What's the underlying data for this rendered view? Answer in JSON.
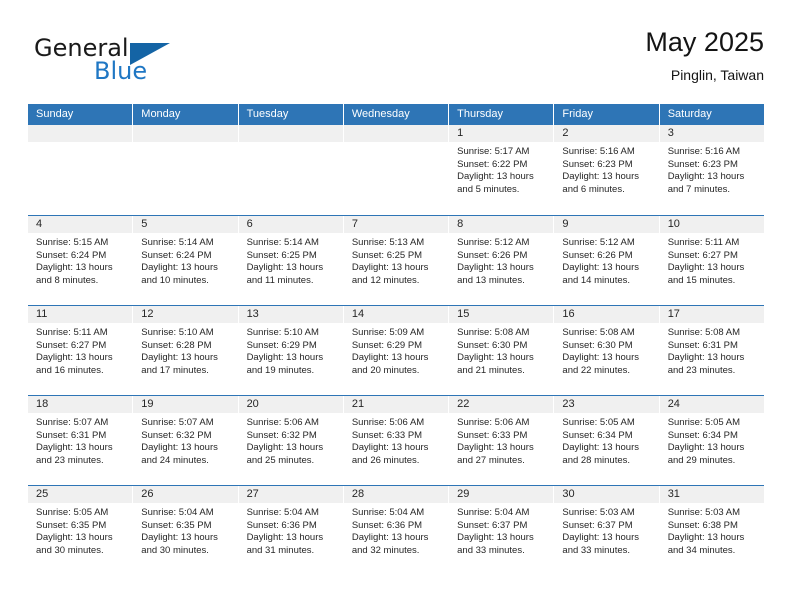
{
  "brand": {
    "name_primary": "General",
    "name_secondary": "Blue",
    "flag_icon": "triangle-flag-icon",
    "accent_color": "#1464a5"
  },
  "header": {
    "title": "May 2025",
    "subtitle": "Pinglin, Taiwan"
  },
  "theme": {
    "header_row_bg": "#2e75b6",
    "row_separator": "#2e75b6",
    "date_band_bg": "#f0f0f0",
    "text_color": "#262626"
  },
  "weekdays": [
    "Sunday",
    "Monday",
    "Tuesday",
    "Wednesday",
    "Thursday",
    "Friday",
    "Saturday"
  ],
  "weeks": [
    [
      {
        "day": "",
        "empty": true
      },
      {
        "day": "",
        "empty": true
      },
      {
        "day": "",
        "empty": true
      },
      {
        "day": "",
        "empty": true
      },
      {
        "day": "1",
        "sunrise": "Sunrise: 5:17 AM",
        "sunset": "Sunset: 6:22 PM",
        "daylight_line1": "Daylight: 13 hours",
        "daylight_line2": "and 5 minutes."
      },
      {
        "day": "2",
        "sunrise": "Sunrise: 5:16 AM",
        "sunset": "Sunset: 6:23 PM",
        "daylight_line1": "Daylight: 13 hours",
        "daylight_line2": "and 6 minutes."
      },
      {
        "day": "3",
        "sunrise": "Sunrise: 5:16 AM",
        "sunset": "Sunset: 6:23 PM",
        "daylight_line1": "Daylight: 13 hours",
        "daylight_line2": "and 7 minutes."
      }
    ],
    [
      {
        "day": "4",
        "sunrise": "Sunrise: 5:15 AM",
        "sunset": "Sunset: 6:24 PM",
        "daylight_line1": "Daylight: 13 hours",
        "daylight_line2": "and 8 minutes."
      },
      {
        "day": "5",
        "sunrise": "Sunrise: 5:14 AM",
        "sunset": "Sunset: 6:24 PM",
        "daylight_line1": "Daylight: 13 hours",
        "daylight_line2": "and 10 minutes."
      },
      {
        "day": "6",
        "sunrise": "Sunrise: 5:14 AM",
        "sunset": "Sunset: 6:25 PM",
        "daylight_line1": "Daylight: 13 hours",
        "daylight_line2": "and 11 minutes."
      },
      {
        "day": "7",
        "sunrise": "Sunrise: 5:13 AM",
        "sunset": "Sunset: 6:25 PM",
        "daylight_line1": "Daylight: 13 hours",
        "daylight_line2": "and 12 minutes."
      },
      {
        "day": "8",
        "sunrise": "Sunrise: 5:12 AM",
        "sunset": "Sunset: 6:26 PM",
        "daylight_line1": "Daylight: 13 hours",
        "daylight_line2": "and 13 minutes."
      },
      {
        "day": "9",
        "sunrise": "Sunrise: 5:12 AM",
        "sunset": "Sunset: 6:26 PM",
        "daylight_line1": "Daylight: 13 hours",
        "daylight_line2": "and 14 minutes."
      },
      {
        "day": "10",
        "sunrise": "Sunrise: 5:11 AM",
        "sunset": "Sunset: 6:27 PM",
        "daylight_line1": "Daylight: 13 hours",
        "daylight_line2": "and 15 minutes."
      }
    ],
    [
      {
        "day": "11",
        "sunrise": "Sunrise: 5:11 AM",
        "sunset": "Sunset: 6:27 PM",
        "daylight_line1": "Daylight: 13 hours",
        "daylight_line2": "and 16 minutes."
      },
      {
        "day": "12",
        "sunrise": "Sunrise: 5:10 AM",
        "sunset": "Sunset: 6:28 PM",
        "daylight_line1": "Daylight: 13 hours",
        "daylight_line2": "and 17 minutes."
      },
      {
        "day": "13",
        "sunrise": "Sunrise: 5:10 AM",
        "sunset": "Sunset: 6:29 PM",
        "daylight_line1": "Daylight: 13 hours",
        "daylight_line2": "and 19 minutes."
      },
      {
        "day": "14",
        "sunrise": "Sunrise: 5:09 AM",
        "sunset": "Sunset: 6:29 PM",
        "daylight_line1": "Daylight: 13 hours",
        "daylight_line2": "and 20 minutes."
      },
      {
        "day": "15",
        "sunrise": "Sunrise: 5:08 AM",
        "sunset": "Sunset: 6:30 PM",
        "daylight_line1": "Daylight: 13 hours",
        "daylight_line2": "and 21 minutes."
      },
      {
        "day": "16",
        "sunrise": "Sunrise: 5:08 AM",
        "sunset": "Sunset: 6:30 PM",
        "daylight_line1": "Daylight: 13 hours",
        "daylight_line2": "and 22 minutes."
      },
      {
        "day": "17",
        "sunrise": "Sunrise: 5:08 AM",
        "sunset": "Sunset: 6:31 PM",
        "daylight_line1": "Daylight: 13 hours",
        "daylight_line2": "and 23 minutes."
      }
    ],
    [
      {
        "day": "18",
        "sunrise": "Sunrise: 5:07 AM",
        "sunset": "Sunset: 6:31 PM",
        "daylight_line1": "Daylight: 13 hours",
        "daylight_line2": "and 23 minutes."
      },
      {
        "day": "19",
        "sunrise": "Sunrise: 5:07 AM",
        "sunset": "Sunset: 6:32 PM",
        "daylight_line1": "Daylight: 13 hours",
        "daylight_line2": "and 24 minutes."
      },
      {
        "day": "20",
        "sunrise": "Sunrise: 5:06 AM",
        "sunset": "Sunset: 6:32 PM",
        "daylight_line1": "Daylight: 13 hours",
        "daylight_line2": "and 25 minutes."
      },
      {
        "day": "21",
        "sunrise": "Sunrise: 5:06 AM",
        "sunset": "Sunset: 6:33 PM",
        "daylight_line1": "Daylight: 13 hours",
        "daylight_line2": "and 26 minutes."
      },
      {
        "day": "22",
        "sunrise": "Sunrise: 5:06 AM",
        "sunset": "Sunset: 6:33 PM",
        "daylight_line1": "Daylight: 13 hours",
        "daylight_line2": "and 27 minutes."
      },
      {
        "day": "23",
        "sunrise": "Sunrise: 5:05 AM",
        "sunset": "Sunset: 6:34 PM",
        "daylight_line1": "Daylight: 13 hours",
        "daylight_line2": "and 28 minutes."
      },
      {
        "day": "24",
        "sunrise": "Sunrise: 5:05 AM",
        "sunset": "Sunset: 6:34 PM",
        "daylight_line1": "Daylight: 13 hours",
        "daylight_line2": "and 29 minutes."
      }
    ],
    [
      {
        "day": "25",
        "sunrise": "Sunrise: 5:05 AM",
        "sunset": "Sunset: 6:35 PM",
        "daylight_line1": "Daylight: 13 hours",
        "daylight_line2": "and 30 minutes."
      },
      {
        "day": "26",
        "sunrise": "Sunrise: 5:04 AM",
        "sunset": "Sunset: 6:35 PM",
        "daylight_line1": "Daylight: 13 hours",
        "daylight_line2": "and 30 minutes."
      },
      {
        "day": "27",
        "sunrise": "Sunrise: 5:04 AM",
        "sunset": "Sunset: 6:36 PM",
        "daylight_line1": "Daylight: 13 hours",
        "daylight_line2": "and 31 minutes."
      },
      {
        "day": "28",
        "sunrise": "Sunrise: 5:04 AM",
        "sunset": "Sunset: 6:36 PM",
        "daylight_line1": "Daylight: 13 hours",
        "daylight_line2": "and 32 minutes."
      },
      {
        "day": "29",
        "sunrise": "Sunrise: 5:04 AM",
        "sunset": "Sunset: 6:37 PM",
        "daylight_line1": "Daylight: 13 hours",
        "daylight_line2": "and 33 minutes."
      },
      {
        "day": "30",
        "sunrise": "Sunrise: 5:03 AM",
        "sunset": "Sunset: 6:37 PM",
        "daylight_line1": "Daylight: 13 hours",
        "daylight_line2": "and 33 minutes."
      },
      {
        "day": "31",
        "sunrise": "Sunrise: 5:03 AM",
        "sunset": "Sunset: 6:38 PM",
        "daylight_line1": "Daylight: 13 hours",
        "daylight_line2": "and 34 minutes."
      }
    ]
  ]
}
